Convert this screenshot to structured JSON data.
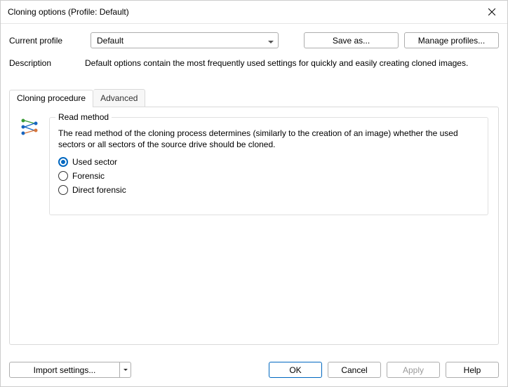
{
  "window": {
    "title": "Cloning options (Profile: Default)"
  },
  "profile": {
    "label": "Current profile",
    "selected": "Default",
    "save_as": "Save as...",
    "manage": "Manage profiles..."
  },
  "description": {
    "label": "Description",
    "text": "Default options contain the most frequently used settings for quickly and easily creating cloned images."
  },
  "tabs": {
    "cloning": "Cloning procedure",
    "advanced": "Advanced"
  },
  "read_method": {
    "legend": "Read method",
    "help": "The read method of the cloning process determines (similarly to the creation of an image) whether the used sectors or all sectors of the source drive should be cloned.",
    "options": {
      "used_sector": "Used sector",
      "forensic": "Forensic",
      "direct_forensic": "Direct forensic"
    },
    "selected": "used_sector"
  },
  "footer": {
    "import": "Import settings...",
    "ok": "OK",
    "cancel": "Cancel",
    "apply": "Apply",
    "help": "Help"
  }
}
